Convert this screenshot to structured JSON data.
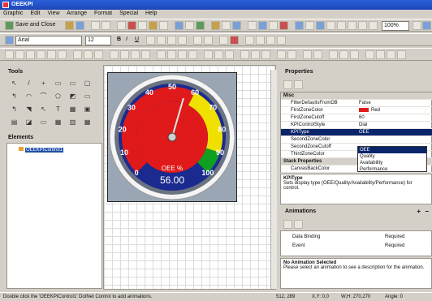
{
  "window": {
    "title": "OEEKPI"
  },
  "menu": [
    "Graphic",
    "Edit",
    "View",
    "Arrange",
    "Format",
    "Special",
    "Help"
  ],
  "toolbar": {
    "save_label": "Save and Close",
    "zoom_value": "100%"
  },
  "format_toolbar": {
    "font_value": "Arial",
    "size_value": "12",
    "bold": "B",
    "italic": "I",
    "underline": "U"
  },
  "tools": {
    "title": "Tools",
    "glyphs": [
      "↖",
      "/",
      "+",
      "▭",
      "▭",
      "▢",
      "↰",
      "◠",
      "⌒",
      "⬠",
      "◩",
      "▭",
      "↰",
      "◥",
      "↖",
      "T",
      "▦",
      "▣",
      "▤",
      "◪",
      "▭",
      "▦",
      "▥",
      "▦"
    ]
  },
  "elements": {
    "title": "Elements",
    "root_item": "OEEKPIControl1"
  },
  "gauge": {
    "title": "OEE %",
    "value": 56.0,
    "value_label": "56.00",
    "min": 0,
    "max": 100,
    "ticks": [
      "0",
      "10",
      "20",
      "30",
      "40",
      "50",
      "60",
      "70",
      "80",
      "90",
      "100"
    ],
    "first_zone_cutoff": 60,
    "second_zone_cutoff": 90,
    "colors": {
      "first": "#e01a1a",
      "second": "#f0e000",
      "third": "#10a020",
      "dial": "#1b2a8f"
    }
  },
  "properties": {
    "title": "Properties",
    "section_misc": "Misc",
    "rows": [
      {
        "key": "FilterDefaultsFromDB",
        "value": "False"
      },
      {
        "key": "FirstZoneColor",
        "value": "Red"
      },
      {
        "key": "FirstZoneCutoff",
        "value": "60"
      },
      {
        "key": "KPIControlStyle",
        "value": "Dial"
      },
      {
        "key": "KPIType",
        "value": "OEE"
      },
      {
        "key": "SecondZoneColor",
        "value": ""
      },
      {
        "key": "SecondZoneCutoff",
        "value": ""
      },
      {
        "key": "ThirdZoneColor",
        "value": ""
      }
    ],
    "section_stack": "Stack Properties",
    "stack_row": "CanvasBackColor",
    "dropdown": [
      "OEE",
      "Quality",
      "Availability",
      "Performance"
    ],
    "desc_title": "KPIType",
    "desc_text": "Sets display type (OEE/Quality/Availability/Performance) for control."
  },
  "animations": {
    "title": "Animations",
    "rows": [
      {
        "name": "Data Binding",
        "value": "Required"
      },
      {
        "name": "Event",
        "value": "Required"
      }
    ],
    "no_sel_title": "No Animation Selected",
    "no_sel_text": "Please select an animation to see a description for the animation."
  },
  "status": {
    "hint": "Double click the 'OEEKPIControl1' DotNet Control to add animations.",
    "coords": "512, 289",
    "xy": "X,Y: 0,0",
    "wh": "W,H: 270,270",
    "angle": "Angle: 0"
  }
}
